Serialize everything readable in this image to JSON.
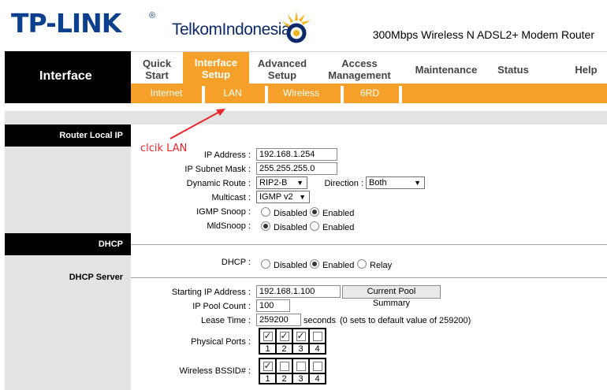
{
  "header": {
    "brand": "TP-LINK",
    "brand_mark": "®",
    "partner": "TelkomIndonesia",
    "product": "300Mbps Wireless N ADSL2+ Modem Router"
  },
  "nav": {
    "section": "Interface",
    "tabs": [
      {
        "label": "Quick\nStart"
      },
      {
        "label": "Interface\nSetup"
      },
      {
        "label": "Advanced\nSetup"
      },
      {
        "label": "Access\nManagement"
      },
      {
        "label": "Maintenance"
      },
      {
        "label": "Status"
      },
      {
        "label": "Help"
      }
    ],
    "subtabs": [
      "Internet",
      "LAN",
      "Wireless",
      "6RD"
    ]
  },
  "annotation": "clcik LAN",
  "colors": {
    "accent": "#f5a028",
    "brand": "#0d3f8f",
    "annotation": "#e8262a"
  },
  "router_local_ip": {
    "section": "Router Local IP",
    "ip_label": "IP Address",
    "ip_value": "192.168.1.254",
    "mask_label": "IP Subnet Mask",
    "mask_value": "255.255.255.0",
    "dyn_route_label": "Dynamic Route",
    "dyn_route_value": "RIP2-B",
    "direction_label": "Direction",
    "direction_value": "Both",
    "multicast_label": "Multicast",
    "multicast_value": "IGMP v2",
    "igmp_label": "IGMP Snoop",
    "mld_label": "MldSnoop",
    "disabled": "Disabled",
    "enabled": "Enabled"
  },
  "dhcp": {
    "section": "DHCP",
    "label": "DHCP",
    "opt_disabled": "Disabled",
    "opt_enabled": "Enabled",
    "opt_relay": "Relay"
  },
  "dhcp_server": {
    "section": "DHCP Server",
    "start_label": "Starting IP Address",
    "start_value": "192.168.1.100",
    "pool_button": "Current Pool Summary",
    "count_label": "IP Pool Count",
    "count_value": "100",
    "lease_label": "Lease Time",
    "lease_value": "259200",
    "lease_unit": "seconds",
    "lease_note": "(0 sets to default value of 259200)",
    "ports_label": "Physical Ports",
    "ports": [
      true,
      true,
      true,
      false
    ],
    "bssid_label": "Wireless BSSID#",
    "bssid": [
      true,
      false,
      false,
      false
    ],
    "port_numbers": [
      "1",
      "2",
      "3",
      "4"
    ]
  },
  "separator": ":"
}
